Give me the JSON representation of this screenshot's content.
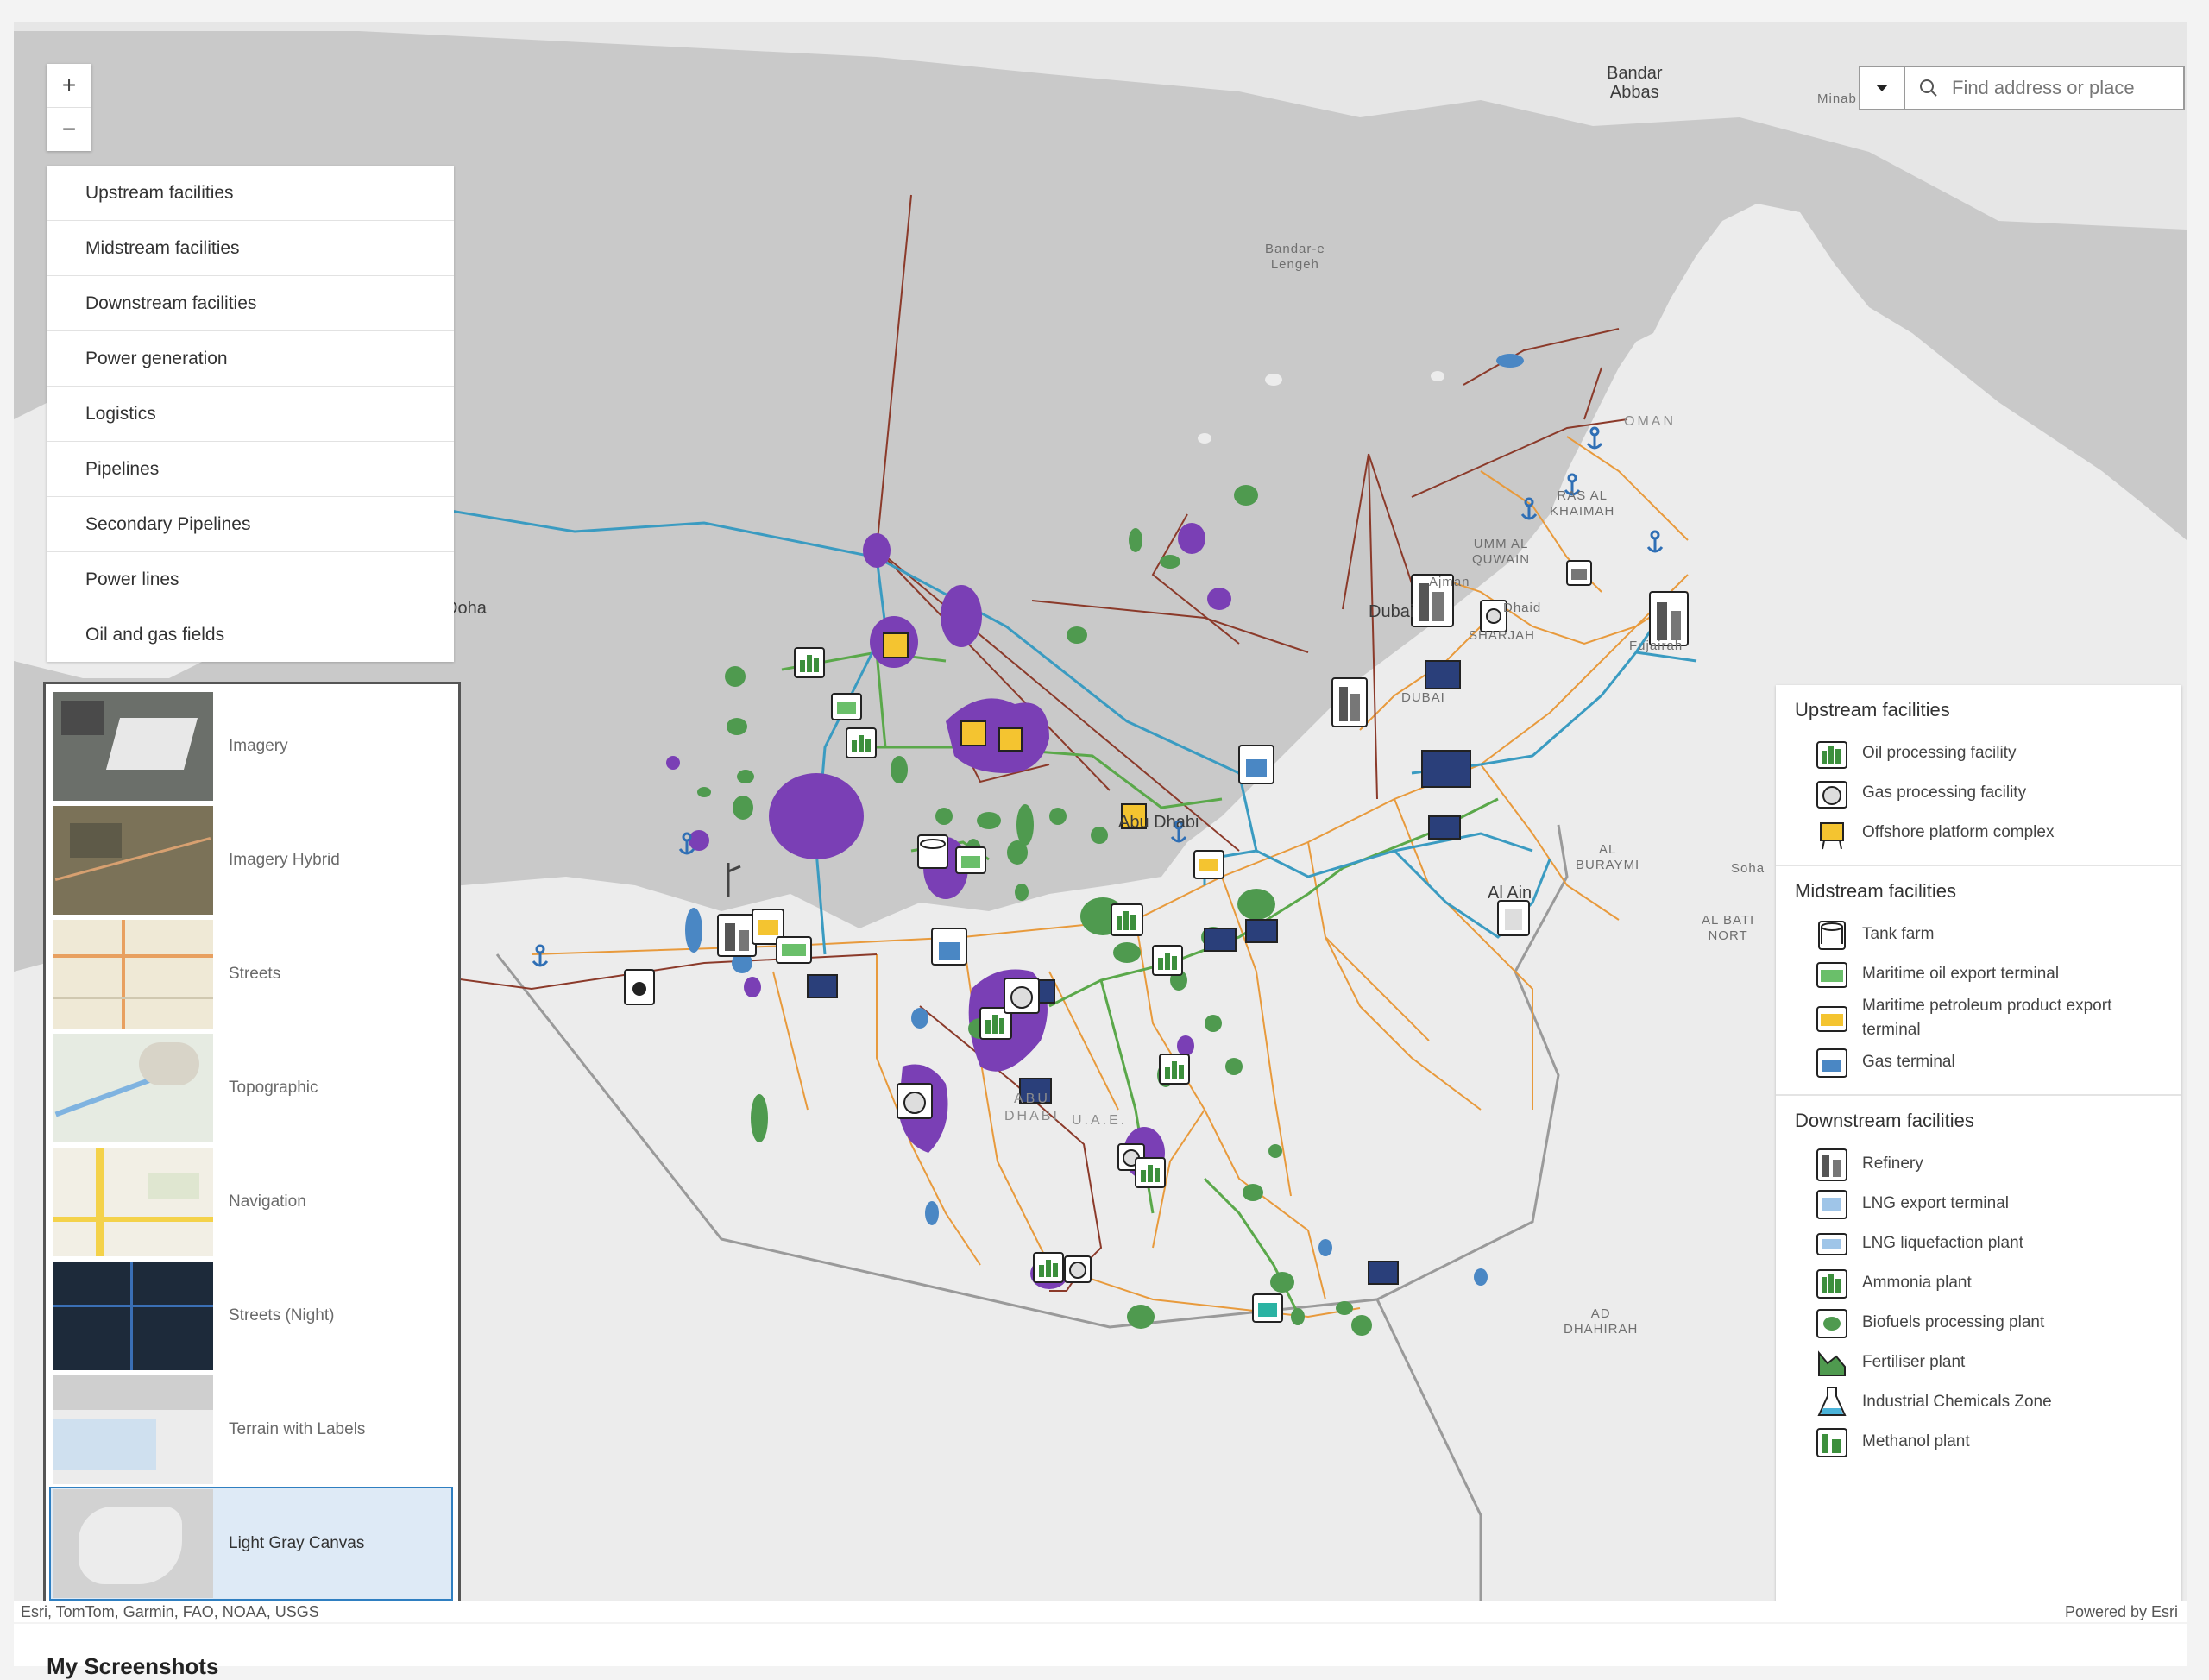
{
  "search": {
    "placeholder": "Find address or place"
  },
  "zoom": {
    "in": "+",
    "out": "−"
  },
  "layers": [
    "Upstream facilities",
    "Midstream facilities",
    "Downstream facilities",
    "Power generation",
    "Logistics",
    "Pipelines",
    "Secondary Pipelines",
    "Power lines",
    "Oil and gas fields"
  ],
  "basemaps": [
    {
      "label": "Imagery",
      "selected": false
    },
    {
      "label": "Imagery Hybrid",
      "selected": false
    },
    {
      "label": "Streets",
      "selected": false
    },
    {
      "label": "Topographic",
      "selected": false
    },
    {
      "label": "Navigation",
      "selected": false
    },
    {
      "label": "Streets (Night)",
      "selected": false
    },
    {
      "label": "Terrain with Labels",
      "selected": false
    },
    {
      "label": "Light Gray Canvas",
      "selected": true
    }
  ],
  "legend": {
    "upstream": {
      "title": "Upstream facilities",
      "items": [
        "Oil processing facility",
        "Gas processing facility",
        "Offshore platform complex"
      ]
    },
    "midstream": {
      "title": "Midstream facilities",
      "items": [
        "Tank farm",
        "Maritime oil export terminal",
        "Maritime petroleum product export terminal",
        "Gas terminal"
      ]
    },
    "downstream": {
      "title": "Downstream facilities",
      "items": [
        "Refinery",
        "LNG export terminal",
        "LNG liquefaction plant",
        "Ammonia plant",
        "Biofuels processing plant",
        "Fertiliser plant",
        "Industrial Chemicals Zone",
        "Methanol plant"
      ]
    }
  },
  "places": {
    "bandar_abbas": "Bandar Abbas",
    "bandar_abbas_1": "Bandar",
    "bandar_abbas_2": "Abbas",
    "minab": "Minab",
    "bandar_lengeh_1": "Bandar-e",
    "bandar_lengeh_2": "Lengeh",
    "oman": "OMAN",
    "doha": "Doha",
    "dubai": "Dubai",
    "dubai_region": "DUBAI",
    "abu_dhabi": "Abu Dhabi",
    "abu_dhabi_region_1": "ABU",
    "abu_dhabi_region_2": "DHABI",
    "uae": "U.A.E.",
    "al_ain": "Al Ain",
    "al_buraymi_1": "AL",
    "al_buraymi_2": "BURAYMI",
    "al_batinah_1": "AL BATI",
    "al_batinah_2": "NORT",
    "ad_dhahirah_1": "AD",
    "ad_dhahirah_2": "DHAHIRAH",
    "fujairah": "Fujairah",
    "dhaid": "Dhaid",
    "sharjah": "SHARJAH",
    "umm_al_quwain_1": "UMM AL",
    "umm_al_quwain_2": "QUWAIN",
    "ras_al_khaimah_1": "RAS AL",
    "ras_al_khaimah_2": "KHAIMAH",
    "sohar": "Soha",
    "ajman": "Ajman"
  },
  "attribution": {
    "sources": "Esri, TomTom, Garmin, FAO, NOAA, USGS",
    "powered": "Powered by Esri"
  },
  "footer": {
    "title": "My Screenshots"
  },
  "colors": {
    "water": "#c9c9c9",
    "land": "#ececec",
    "pipeline": "#3a9bc1",
    "secondary_pipeline": "#5aa84a",
    "power_line": "#e89a3c",
    "oil_gas_field_oil": "#4f9a4f",
    "oil_gas_field_gas": "#7a3fb5",
    "selected": "#deeaf6"
  }
}
